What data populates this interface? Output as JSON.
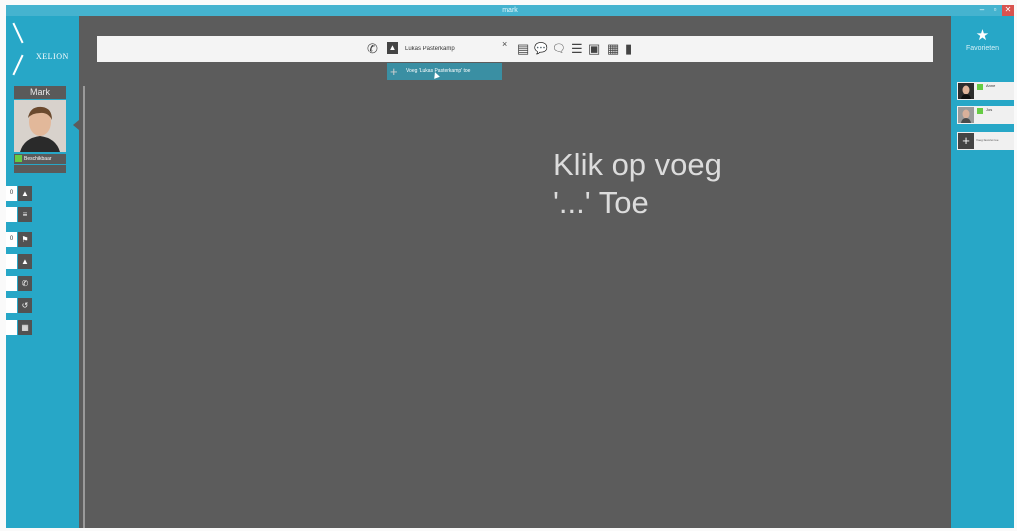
{
  "window": {
    "title": "mark",
    "minimize": "–",
    "maximize": "▫",
    "close": "✕"
  },
  "sidebar": {
    "logo_text": "XELION",
    "user_name": "Mark",
    "status_label": "Beschikbaar",
    "nav": [
      {
        "count": "0",
        "icon": "warning-icon",
        "glyph": "▲"
      },
      {
        "count": "",
        "icon": "list-icon",
        "glyph": "≡"
      },
      {
        "count": "0",
        "icon": "flag-icon",
        "glyph": "⚑"
      },
      {
        "count": "",
        "icon": "contact-icon",
        "glyph": "▲"
      },
      {
        "count": "",
        "icon": "phone-icon",
        "glyph": "✆"
      },
      {
        "count": "",
        "icon": "history-icon",
        "glyph": "↺"
      },
      {
        "count": "",
        "icon": "calendar-icon",
        "glyph": "▦"
      }
    ]
  },
  "search": {
    "phone_glyph": "✆",
    "contact_glyph": "▲",
    "value": "Lukas Pasterkamp",
    "clear_glyph": "×",
    "toolbar_icons": [
      {
        "name": "document-icon",
        "glyph": "▤"
      },
      {
        "name": "chat-icon",
        "glyph": "💬"
      },
      {
        "name": "conversation-icon",
        "glyph": "🗨"
      },
      {
        "name": "list-icon",
        "glyph": "☰"
      },
      {
        "name": "calendar-icon",
        "glyph": "▣"
      },
      {
        "name": "grid-icon",
        "glyph": "▦"
      },
      {
        "name": "bar-chart-icon",
        "glyph": "▮"
      }
    ]
  },
  "suggestion": {
    "plus": "+",
    "text": "Voeg 'Lukas Pasterkamp' toe"
  },
  "main": {
    "caption_line1": "Klik op voeg",
    "caption_line2": "'...' Toe"
  },
  "favorites": {
    "star": "★",
    "label": "Favorieten",
    "items": [
      {
        "name": "Anne",
        "status_color": "#66cc44"
      },
      {
        "name": "Jos",
        "status_color": "#66cc44"
      }
    ],
    "add_glyph": "+",
    "add_text": "Voeg favoriet toe"
  }
}
